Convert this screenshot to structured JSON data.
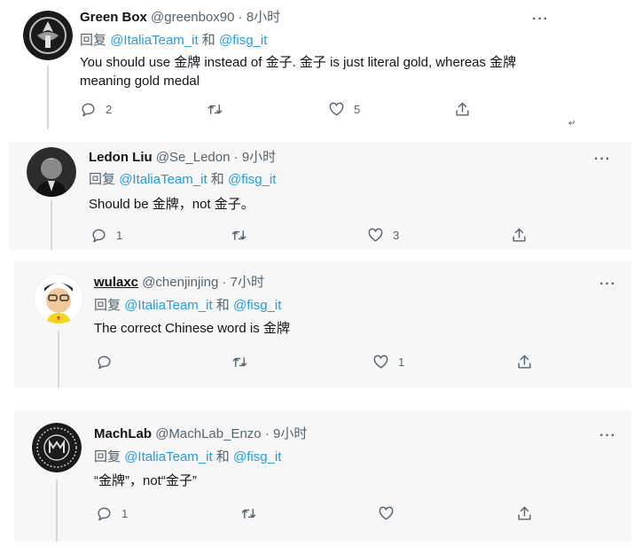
{
  "tweets": [
    {
      "name": "Green Box",
      "handle": "@greenbox90",
      "dot": "·",
      "time": "8小时",
      "reply_prefix": "回复",
      "mention1": "@ItaliaTeam_it",
      "conj": "和",
      "mention2": "@fisg_it",
      "text": "You should use 金牌 instead of 金子. 金子 is just literal gold, whereas 金牌 meaning gold medal",
      "reply_count": "2",
      "retweet_count": "",
      "like_count": "5"
    },
    {
      "name": "Ledon Liu",
      "handle": "@Se_Ledon",
      "dot": "·",
      "time": "9小时",
      "reply_prefix": "回复",
      "mention1": "@ItaliaTeam_it",
      "conj": "和",
      "mention2": "@fisg_it",
      "text": "Should be 金牌，not 金子。",
      "reply_count": "1",
      "retweet_count": "",
      "like_count": "3"
    },
    {
      "name": "wulaxc",
      "handle": "@chenjinjing",
      "dot": "·",
      "time": "7小时",
      "reply_prefix": "回复",
      "mention1": "@ItaliaTeam_it",
      "conj": "和",
      "mention2": "@fisg_it",
      "text": "The correct Chinese word is 金牌",
      "reply_count": "",
      "retweet_count": "",
      "like_count": "1"
    },
    {
      "name": "MachLab",
      "handle": "@MachLab_Enzo",
      "dot": "·",
      "time": "9小时",
      "reply_prefix": "回复",
      "mention1": "@ItaliaTeam_it",
      "conj": "和",
      "mention2": "@fisg_it",
      "text": "“金牌”，not“金子”",
      "reply_count": "1",
      "retweet_count": "",
      "like_count": ""
    }
  ],
  "more_label": "···",
  "return_mark": "↵",
  "icons": [
    "reply-icon",
    "retweet-icon",
    "like-icon",
    "share-icon",
    "more-icon"
  ],
  "colors": {
    "mention": "#1d9bf0",
    "secondary": "#536471",
    "text": "#0f1419",
    "panel": "#f7f7f7"
  }
}
